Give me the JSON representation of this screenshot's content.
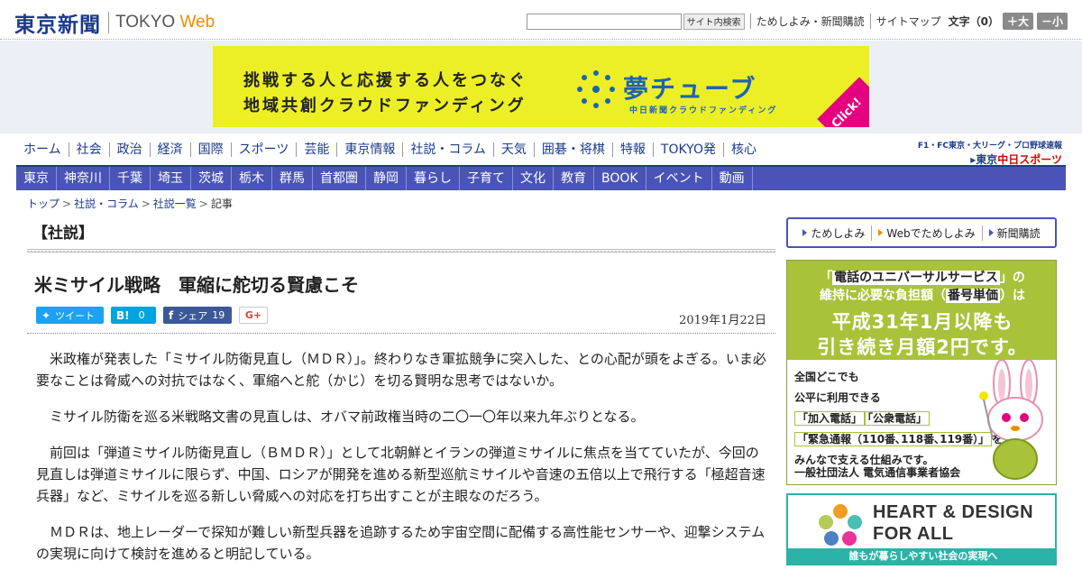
{
  "header": {
    "logo_jp": "東京新聞",
    "logo_en_main": "TOKYO ",
    "logo_en_accent": "Web",
    "search_placeholder": "",
    "search_button": "サイト内検索",
    "links": [
      "ためしよみ・新聞購読",
      "サイトマップ"
    ],
    "font_size_label": "文字（0）",
    "font_larger": "＋大",
    "font_smaller": "－小"
  },
  "banner": {
    "line1": "挑戦する人と応援する人をつなぐ",
    "line2": "地域共創クラウドファンディング",
    "brand": "夢チューブ",
    "sub": "中日新聞クラウドファンディング",
    "click": "Click!"
  },
  "nav_main": [
    "ホーム",
    "社会",
    "政治",
    "経済",
    "国際",
    "スポーツ",
    "芸能",
    "東京情報",
    "社説・コラム",
    "天気",
    "囲碁・将棋",
    "特報",
    "TOKYO発",
    "核心"
  ],
  "chunichi": {
    "top": "F1・FC東京・大リーグ・プロ野球速報",
    "prefix": "▸東京",
    "name": "中日スポーツ"
  },
  "nav_sub": [
    "東京",
    "神奈川",
    "千葉",
    "埼玉",
    "茨城",
    "栃木",
    "群馬",
    "首都圏",
    "静岡",
    "暮らし",
    "子育て",
    "文化",
    "教育",
    "BOOK",
    "イベント",
    "動画"
  ],
  "breadcrumb": [
    "トップ",
    "社説・コラム",
    "社説一覧",
    "記事"
  ],
  "article": {
    "section": "【社説】",
    "headline": "米ミサイル戦略　軍縮に舵切る賢慮こそ",
    "share": {
      "tweet": "ツイート",
      "hatena_count": "0",
      "fb_label": "シェア",
      "fb_count": "19",
      "gplus": "G+"
    },
    "date": "2019年1月22日",
    "paragraphs": [
      "米政権が発表した「ミサイル防衛見直し（ＭＤＲ）」。終わりなき軍拡競争に突入した、との心配が頭をよぎる。いま必要なことは脅威への対抗ではなく、軍縮へと舵（かじ）を切る賢明な思考ではないか。",
      "ミサイル防衛を巡る米戦略文書の見直しは、オバマ前政権当時の二〇一〇年以来九年ぶりとなる。",
      "前回は「弾道ミサイル防衛見直し（ＢＭＤＲ）」として北朝鮮とイランの弾道ミサイルに焦点を当てていたが、今回の見直しは弾道ミサイルに限らず、中国、ロシアが開発を進める新型巡航ミサイルや音速の五倍以上で飛行する「極超音速兵器」など、ミサイルを巡る新しい脅威への対応を打ち出すことが主眼なのだろう。",
      "ＭＤＲは、地上レーダーで探知が難しい新型兵器を追跡するため宇宙空間に配備する高性能センサーや、迎撃システムの実現に向けて検討を進めると明記している。"
    ]
  },
  "sidebar": {
    "links": [
      "ためしよみ",
      "Webでためしよみ",
      "新聞購読"
    ],
    "ad1": {
      "l1_pre": "「",
      "l1_hl": "電話のユニバーサルサービス",
      "l1_post": "」の",
      "l2_pre": "維持に必要な負担額（",
      "l2_hl": "番号単価",
      "l2_post": "）は",
      "big1": "平成31年1月以降も",
      "big2": "引き続き月額2円です。",
      "t1": "全国どこでも",
      "t2": "公平に利用できる",
      "t3a": "「加入電話」",
      "t3b": "「公衆電話」",
      "t4a": "「緊急通報（110番､118番､119番）」",
      "t4b": "を",
      "t5": "みんなで支える仕組みです。",
      "foot": "一般社団法人 電気通信事業者協会"
    },
    "ad2": {
      "t1": "HEART & DESIGN",
      "t2": "FOR ALL",
      "bar": "誰もが暮らしやすい社会の実現へ"
    }
  }
}
